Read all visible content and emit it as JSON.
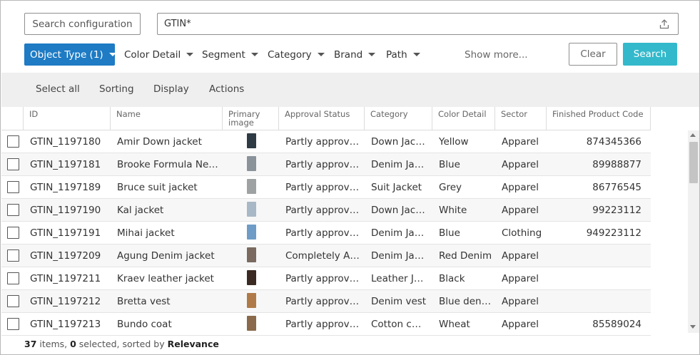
{
  "search": {
    "config_label": "Search configuration",
    "query_value": "GTIN*",
    "upload_icon": "upload-icon"
  },
  "filters": [
    {
      "label": "Object Type (1)",
      "active": true
    },
    {
      "label": "Color Detail",
      "active": false
    },
    {
      "label": "Segment",
      "active": false
    },
    {
      "label": "Category",
      "active": false
    },
    {
      "label": "Brand",
      "active": false
    },
    {
      "label": "Path",
      "active": false
    }
  ],
  "show_more_label": "Show more...",
  "clear_label": "Clear",
  "search_label": "Search",
  "toolbar": {
    "select_all": "Select all",
    "sorting": "Sorting",
    "display": "Display",
    "actions": "Actions"
  },
  "table": {
    "columns": {
      "id": "ID",
      "name": "Name",
      "image": "Primary image",
      "approval": "Approval Status",
      "category": "Category",
      "color": "Color Detail",
      "sector": "Sector",
      "code": "Finished Product Code"
    },
    "rows": [
      {
        "id": "GTIN_1197180",
        "name": "Amir Down jacket",
        "approval": "Partly approved",
        "category": "Down Jacket",
        "color": "Yellow",
        "sector": "Apparel",
        "code": "874345366",
        "thumb": "#2e3a44"
      },
      {
        "id": "GTIN_1197181",
        "name": "Brooke Formula New jacket",
        "approval": "Partly approved",
        "category": "Denim Jacket",
        "color": "Blue",
        "sector": "Apparel",
        "code": "89988877",
        "thumb": "#8a929a"
      },
      {
        "id": "GTIN_1197189",
        "name": "Bruce suit jacket",
        "approval": "Partly approved",
        "category": "Suit Jacket",
        "color": "Grey",
        "sector": "Apparel",
        "code": "86776545",
        "thumb": "#9ea2a3"
      },
      {
        "id": "GTIN_1197190",
        "name": "Kal jacket",
        "approval": "Partly approved",
        "category": "Down Jacket",
        "color": "White",
        "sector": "Apparel",
        "code": "99223112",
        "thumb": "#a9b8c6"
      },
      {
        "id": "GTIN_1197191",
        "name": "Mihai jacket",
        "approval": "Partly approved",
        "category": "Denim Jacket",
        "color": "Blue",
        "sector": "Clothing",
        "code": "949223112",
        "thumb": "#6f9cc6"
      },
      {
        "id": "GTIN_1197209",
        "name": "Agung Denim jacket",
        "approval": "Completely Approved",
        "category": "Denim Jacket",
        "color": "Red Denim",
        "sector": "Apparel",
        "code": "",
        "thumb": "#7a6a60"
      },
      {
        "id": "GTIN_1197211",
        "name": "Kraev leather jacket",
        "approval": "Partly approved",
        "category": "Leather Jacket",
        "color": "Black",
        "sector": "Apparel",
        "code": "",
        "thumb": "#3a2a22"
      },
      {
        "id": "GTIN_1197212",
        "name": "Bretta vest",
        "approval": "Partly approved",
        "category": "Denim vest",
        "color": "Blue denim",
        "sector": "Apparel",
        "code": "",
        "thumb": "#b07a48"
      },
      {
        "id": "GTIN_1197213",
        "name": "Bundo coat",
        "approval": "Partly approved",
        "category": "Cotton coat",
        "color": "Wheat",
        "sector": "Apparel",
        "code": "85589024",
        "thumb": "#8a6a4a"
      }
    ]
  },
  "footer": {
    "count": "37",
    "count_suffix": " items, ",
    "selected": "0",
    "selected_suffix": " selected, sorted by ",
    "sort": "Relevance"
  }
}
